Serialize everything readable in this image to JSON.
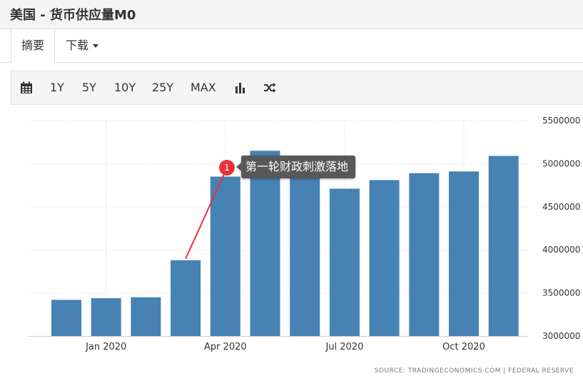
{
  "header": {
    "title": "美国 - 货币供应量M0"
  },
  "tabs": {
    "summary": "摘要",
    "download": "下载"
  },
  "toolbar": {
    "ranges": [
      "1Y",
      "5Y",
      "10Y",
      "25Y",
      "MAX"
    ],
    "icons": [
      "calendar-icon",
      "bar-chart-icon",
      "shuffle-icon"
    ]
  },
  "annotation": {
    "number": "1",
    "text": "第一轮财政刺激落地"
  },
  "source": "SOURCE: TRADINGECONOMICS.COM | FEDERAL RESERVE",
  "colors": {
    "bar": "#4682b4",
    "annotation_dot": "#e8333a",
    "annotation_line": "#e8333a",
    "annotation_box": "#58585a"
  },
  "chart_data": {
    "type": "bar",
    "categories": [
      "2019-12",
      "2020-01",
      "2020-02",
      "2020-03",
      "2020-04",
      "2020-05",
      "2020-06",
      "2020-07",
      "2020-08",
      "2020-09",
      "2020-10",
      "2020-11"
    ],
    "values": [
      3420000,
      3440000,
      3450000,
      3880000,
      4850000,
      5150000,
      4960000,
      4710000,
      4810000,
      4890000,
      4910000,
      5090000
    ],
    "x_tick_labels": [
      {
        "label": "Jan 2020",
        "index": 1
      },
      {
        "label": "Apr 2020",
        "index": 4
      },
      {
        "label": "Jul 2020",
        "index": 7
      },
      {
        "label": "Oct 2020",
        "index": 10
      }
    ],
    "y_ticks": [
      "3000000",
      "3500000",
      "4000000",
      "4500000",
      "5000000",
      "5500000"
    ],
    "ylim": [
      3000000,
      5500000
    ],
    "y_axis_side": "right",
    "grid": true
  }
}
